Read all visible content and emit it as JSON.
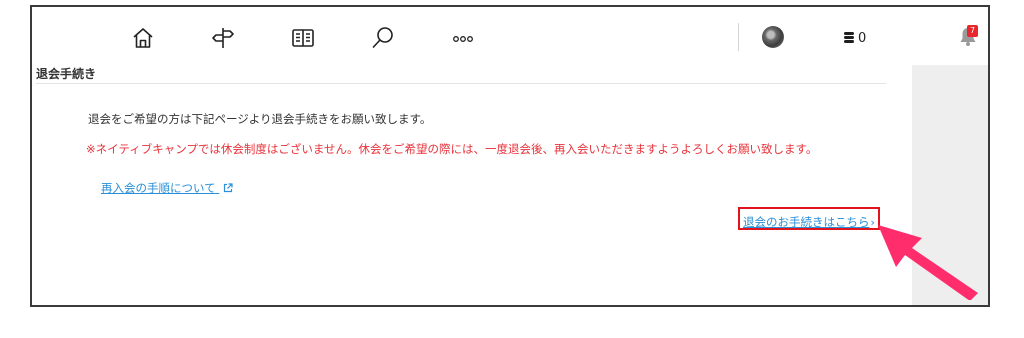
{
  "nav": {
    "icons": [
      "home-icon",
      "signpost-icon",
      "book-icon",
      "search-icon",
      "more-icon"
    ],
    "coins": "0",
    "notifications": "7"
  },
  "main": {
    "section_title": "退会手続き",
    "intro": "退会をご希望の方は下記ページより退会手続きをお願い致します。",
    "notice": "※ネイティブキャンプでは休会制度はございません。休会をご希望の際には、一度退会後、再入会いただきますようよろしくお願い致します。",
    "rejoin_link": "再入会の手順について",
    "withdraw_link": "退会のお手続きはこちら",
    "withdraw_chevron": "›"
  },
  "colors": {
    "notice_red": "#e8323a",
    "link_blue": "#2a8fd6",
    "highlight_red": "#e1141e",
    "arrow_pink": "#ff2d6b"
  }
}
